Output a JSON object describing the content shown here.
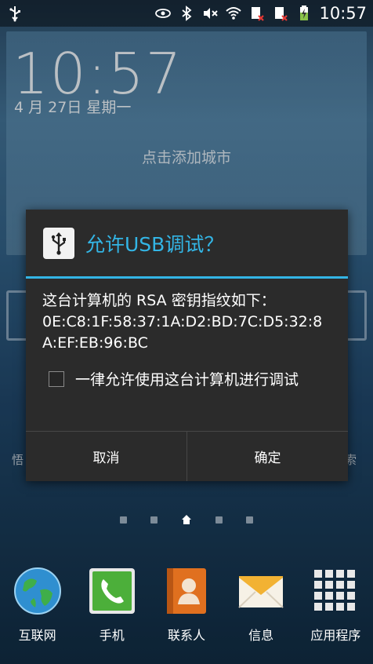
{
  "status_bar": {
    "time": "10:57",
    "icons": [
      "usb-icon",
      "eye-icon",
      "bluetooth-icon",
      "mute-icon",
      "wifi-icon",
      "sim1-icon",
      "sim2-icon",
      "battery-charging-icon"
    ]
  },
  "weather": {
    "clock": "10:57",
    "date": "4 月 27日 星期一",
    "city_hint": "点击添加城市"
  },
  "background_labels": {
    "left": "悟",
    "right": "索"
  },
  "dialog": {
    "title": "允许USB调试？",
    "message_line1": "这台计算机的 RSA 密钥指纹如下：",
    "fingerprint": "0E:C8:1F:58:37:1A:D2:BD:7C:D5:32:8A:EF:EB:96:BC",
    "checkbox_label": "一律允许使用这台计算机进行调试",
    "checkbox_checked": false,
    "cancel_label": "取消",
    "ok_label": "确定",
    "accent_color": "#33b5e5"
  },
  "dock": {
    "items": [
      {
        "label": "互联网",
        "icon": "globe-icon"
      },
      {
        "label": "手机",
        "icon": "phone-icon"
      },
      {
        "label": "联系人",
        "icon": "contacts-icon"
      },
      {
        "label": "信息",
        "icon": "message-icon"
      },
      {
        "label": "应用程序",
        "icon": "apps-grid-icon"
      }
    ]
  }
}
